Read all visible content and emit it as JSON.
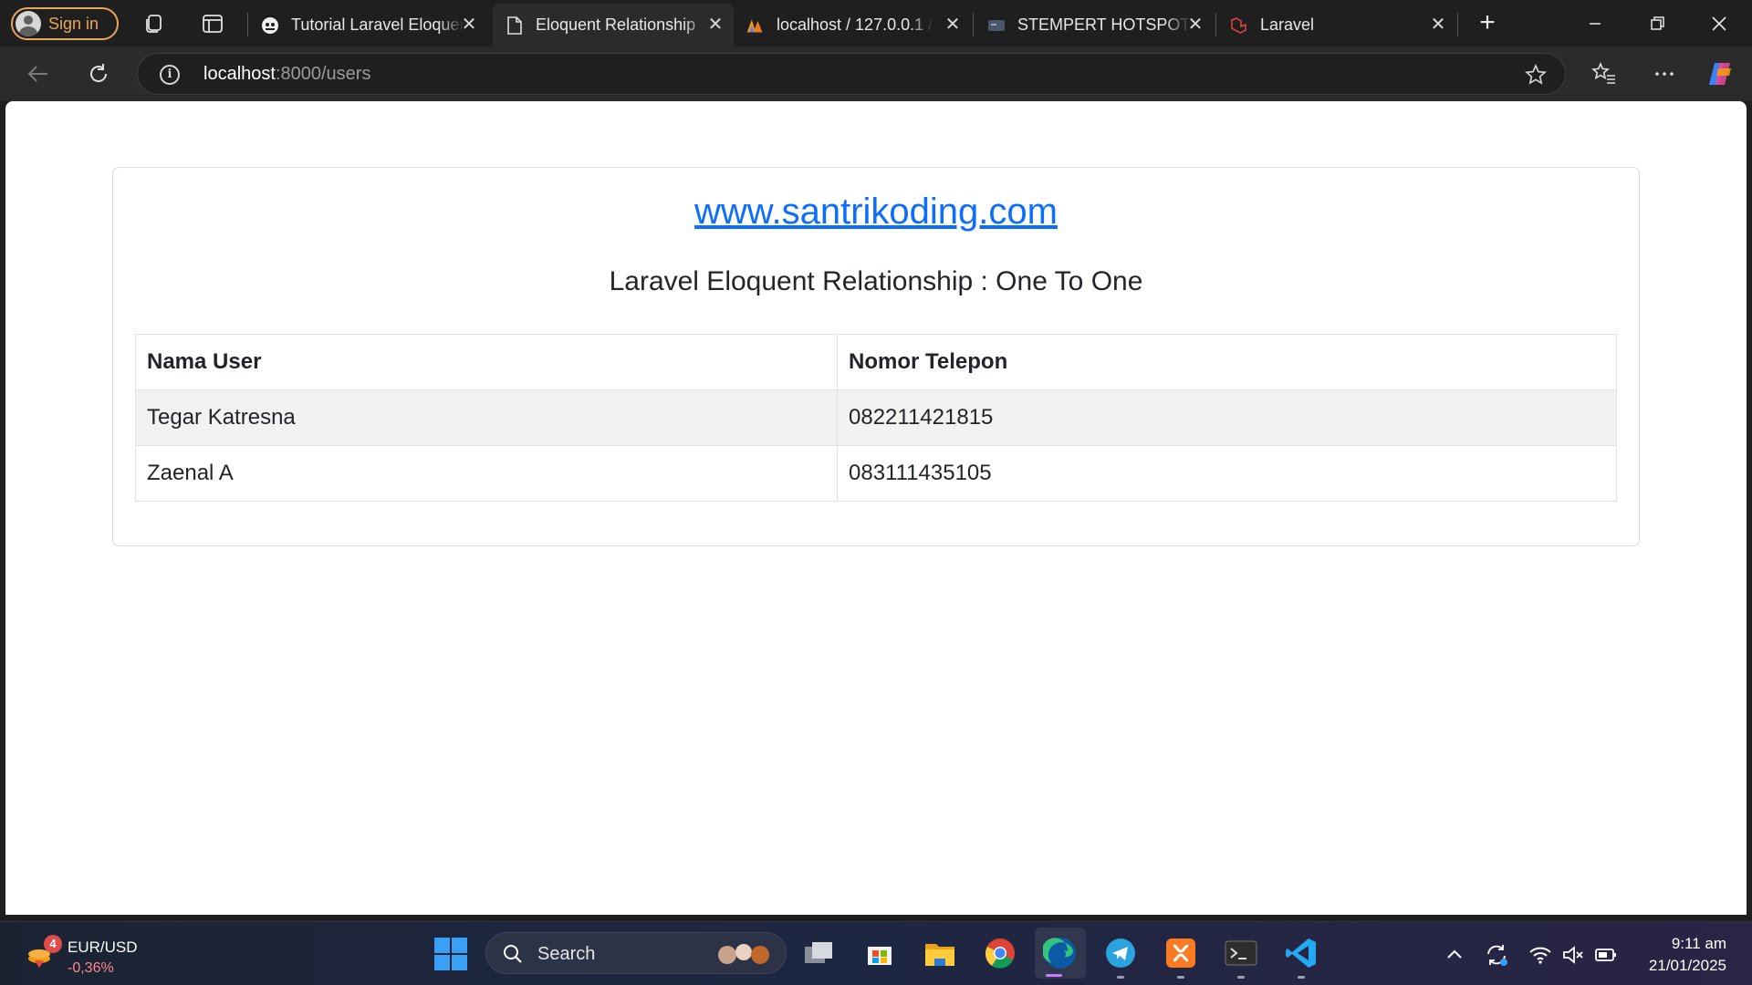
{
  "browser": {
    "signin_label": "Sign in",
    "tabs": [
      {
        "title": "Tutorial Laravel Eloquent Relationship",
        "icon": "santrikoding-icon"
      },
      {
        "title": "Eloquent Relationship",
        "icon": "page-icon"
      },
      {
        "title": "localhost / 127.0.0.1 / ",
        "icon": "phpmyadmin-icon"
      },
      {
        "title": "STEMPERT HOTSPOT",
        "icon": "hotspot-icon"
      },
      {
        "title": "Laravel",
        "icon": "laravel-icon"
      }
    ],
    "address": {
      "host": "localhost",
      "path": ":8000/users"
    }
  },
  "page": {
    "site_link": "www.santrikoding.com",
    "heading": "Laravel Eloquent Relationship : One To One",
    "table": {
      "headers": [
        "Nama User",
        "Nomor Telepon"
      ],
      "rows": [
        [
          "Tegar Katresna",
          "082211421815"
        ],
        [
          "Zaenal A",
          "083111435105"
        ]
      ]
    }
  },
  "taskbar": {
    "widget": {
      "badge": "4",
      "pair": "EUR/USD",
      "change": "-0,36%"
    },
    "search_label": "Search",
    "clock": {
      "time": "9:11 am",
      "date": "21/01/2025"
    }
  },
  "colors": {
    "link": "#0d6efd",
    "accent_signin": "#e8a65b",
    "stripe": "#f2f2f2"
  }
}
